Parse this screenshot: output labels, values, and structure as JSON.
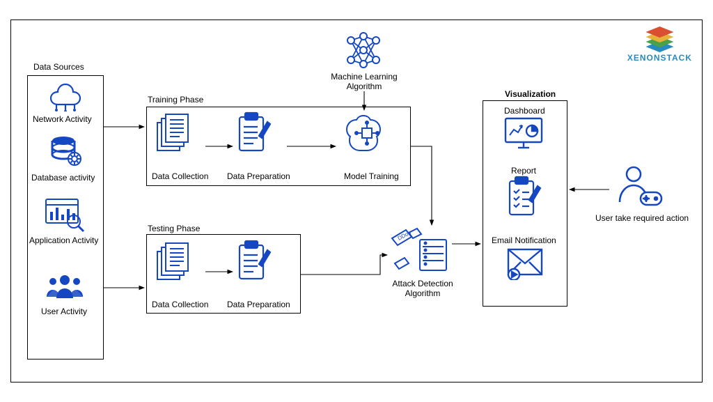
{
  "brand": {
    "name": "XENONSTACK"
  },
  "sections": {
    "dataSources": "Data Sources",
    "trainingPhase": "Training Phase",
    "testingPhase": "Testing Phase",
    "mlAlgorithm": "Machine Learning Algorithm",
    "visualization": "Visualization",
    "attackDetection": "Attack Detection Algorithm",
    "userAction": "User take required action"
  },
  "dataSourceItems": {
    "network": "Network Activity",
    "database": "Database activity",
    "application": "Application Activity",
    "user": "User Activity"
  },
  "trainingItems": {
    "collect": "Data Collection",
    "prepare": "Data Preparation",
    "model": "Model Training"
  },
  "testingItems": {
    "collect": "Data Collection",
    "prepare": "Data Preparation"
  },
  "visualizationItems": {
    "dashboard": "Dashboard",
    "report": "Report",
    "email": "Email Notification"
  },
  "iconText": {
    "ddos": "DDos"
  }
}
